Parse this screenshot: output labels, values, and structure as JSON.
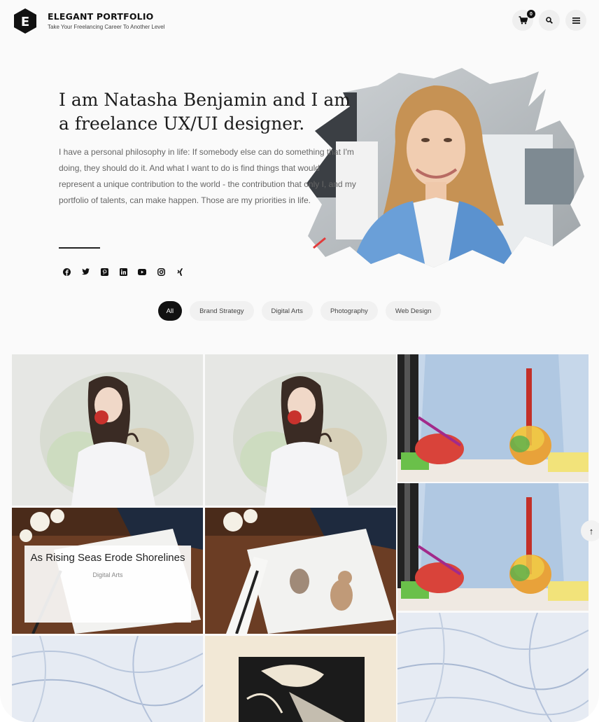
{
  "header": {
    "brand_title": "ELEGANT PORTFOLIO",
    "brand_tagline": "Take Your Freelancing Career To Another Level",
    "logo_letter": "E",
    "cart_count": "0",
    "icons": [
      "cart-icon",
      "search-icon",
      "menu-icon"
    ]
  },
  "hero": {
    "title": "I am Natasha Benjamin and I am a freelance UX/UI designer.",
    "description": "I have a personal philosophy in life: If somebody else can do something that I'm doing, they should do it. And what I want to do is find things that would represent a unique contribution to the world - the contribution that only I, and my portfolio of talents, can make happen. Those are my priorities in life.",
    "social_icons": [
      "facebook-icon",
      "twitter-icon",
      "pinterest-icon",
      "linkedin-icon",
      "youtube-icon",
      "instagram-icon",
      "xing-icon"
    ]
  },
  "filters": [
    {
      "label": "All",
      "active": true
    },
    {
      "label": "Brand Strategy",
      "active": false
    },
    {
      "label": "Digital Arts",
      "active": false
    },
    {
      "label": "Photography",
      "active": false
    },
    {
      "label": "Web Design",
      "active": false
    }
  ],
  "portfolio": {
    "hover_caption": {
      "title": "As Rising Seas Erode Shorelines",
      "category": "Digital Arts"
    }
  },
  "back_to_top": "↑",
  "colors": {
    "accent": "#111111",
    "background": "#fafafa",
    "chip": "#f1f1f1"
  }
}
